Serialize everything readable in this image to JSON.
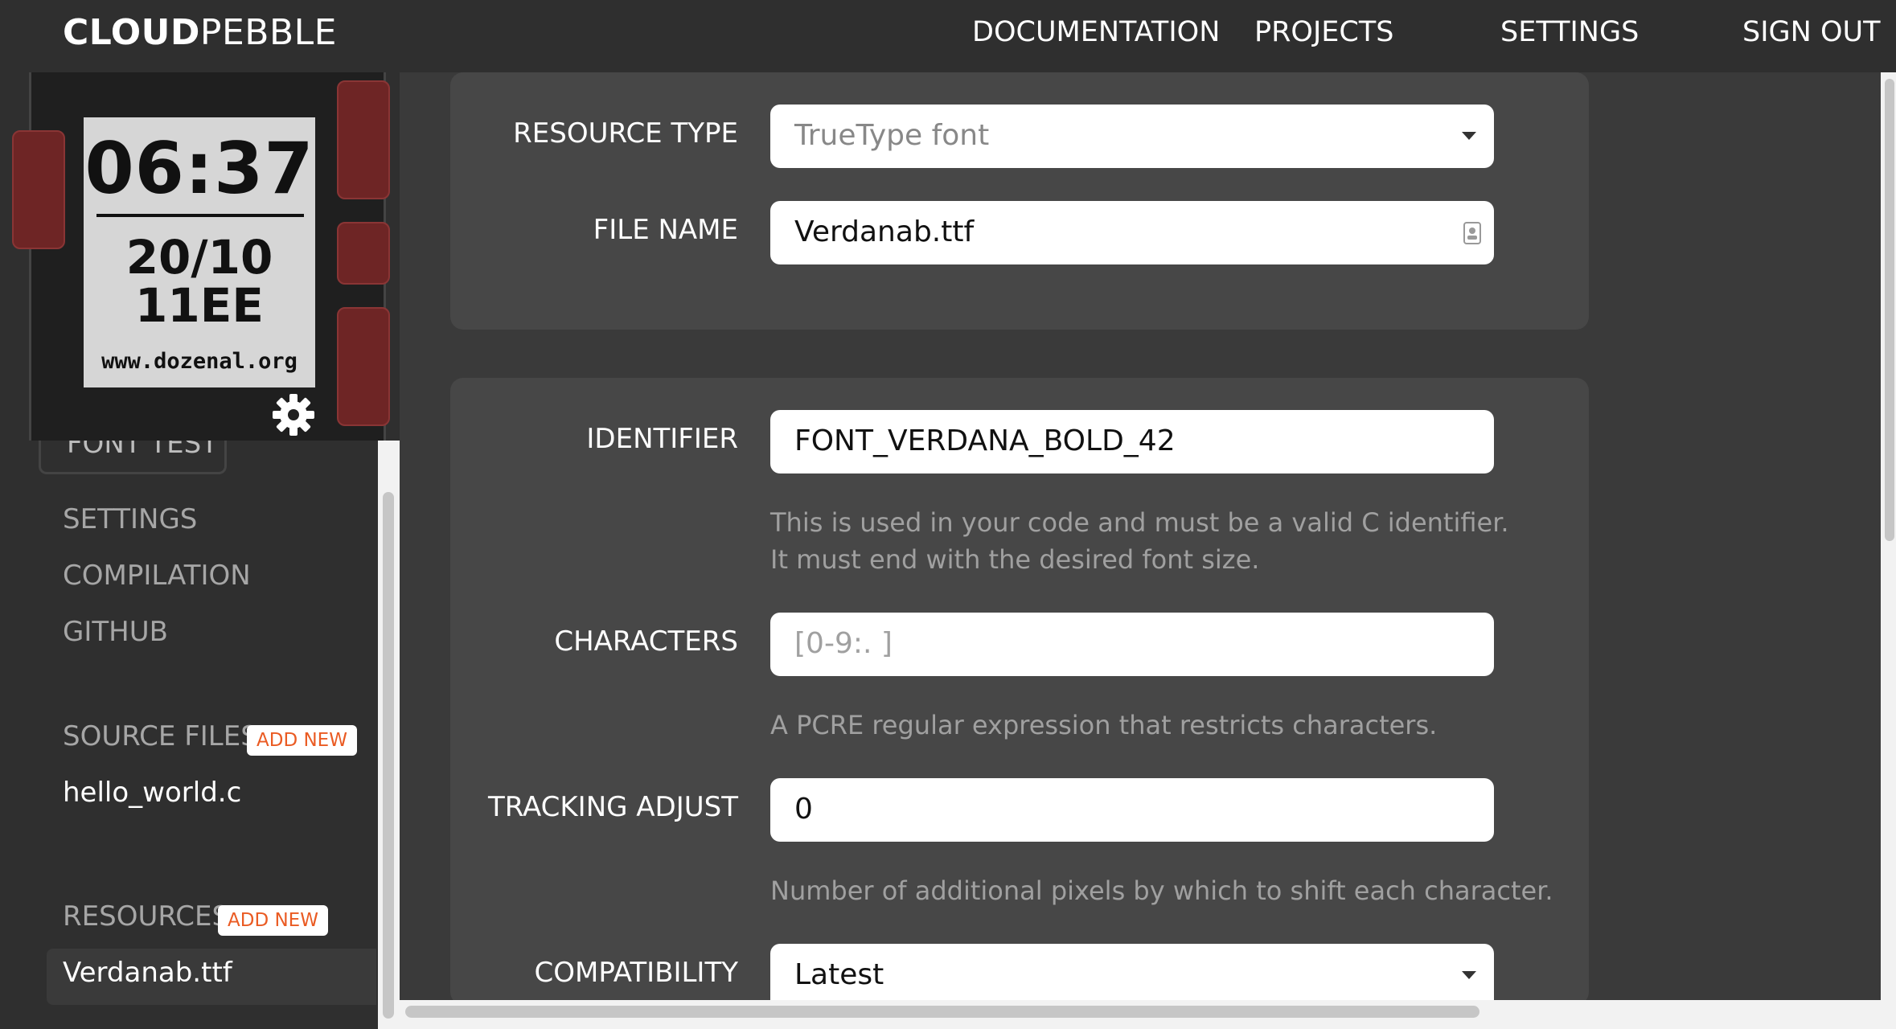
{
  "nav": {
    "brand_bold": "CLOUD",
    "brand_rest": "PEBBLE",
    "links": [
      "DOCUMENTATION",
      "PROJECTS",
      "SETTINGS",
      "SIGN OUT"
    ]
  },
  "emulator": {
    "time": "06:37",
    "date": "20/10",
    "year": "11EE",
    "url": "www.dozenal.org",
    "gear_icon": "gear-icon"
  },
  "sidebar": {
    "project_name": "FONT TEST",
    "items": [
      "SETTINGS",
      "COMPILATION",
      "GITHUB"
    ],
    "source_files_label": "SOURCE FILES",
    "add_new": "ADD NEW",
    "source_files": [
      "hello_world.c"
    ],
    "resources_label": "RESOURCES",
    "resources": [
      "Verdanab.ttf"
    ]
  },
  "form": {
    "resource_type": {
      "label": "RESOURCE TYPE",
      "value": "TrueType font"
    },
    "file_name": {
      "label": "FILE NAME",
      "value": "Verdanab.ttf"
    },
    "identifier": {
      "label": "IDENTIFIER",
      "value": "FONT_VERDANA_BOLD_42",
      "help1": "This is used in your code and must be a valid C identifier.",
      "help2": "It must end with the desired font size."
    },
    "characters": {
      "label": "CHARACTERS",
      "placeholder": "[0-9:. ]",
      "help": "A PCRE regular expression that restricts characters."
    },
    "tracking": {
      "label": "TRACKING ADJUST",
      "value": "0",
      "help": "Number of additional pixels by which to shift each character."
    },
    "compatibility": {
      "label": "COMPATIBILITY",
      "value": "Latest"
    }
  },
  "colors": {
    "background": "#2f2f2f",
    "main": "#3a3a3a",
    "panel": "#474747",
    "accent": "#ea5b23",
    "emulator_button": "#6e2525"
  }
}
